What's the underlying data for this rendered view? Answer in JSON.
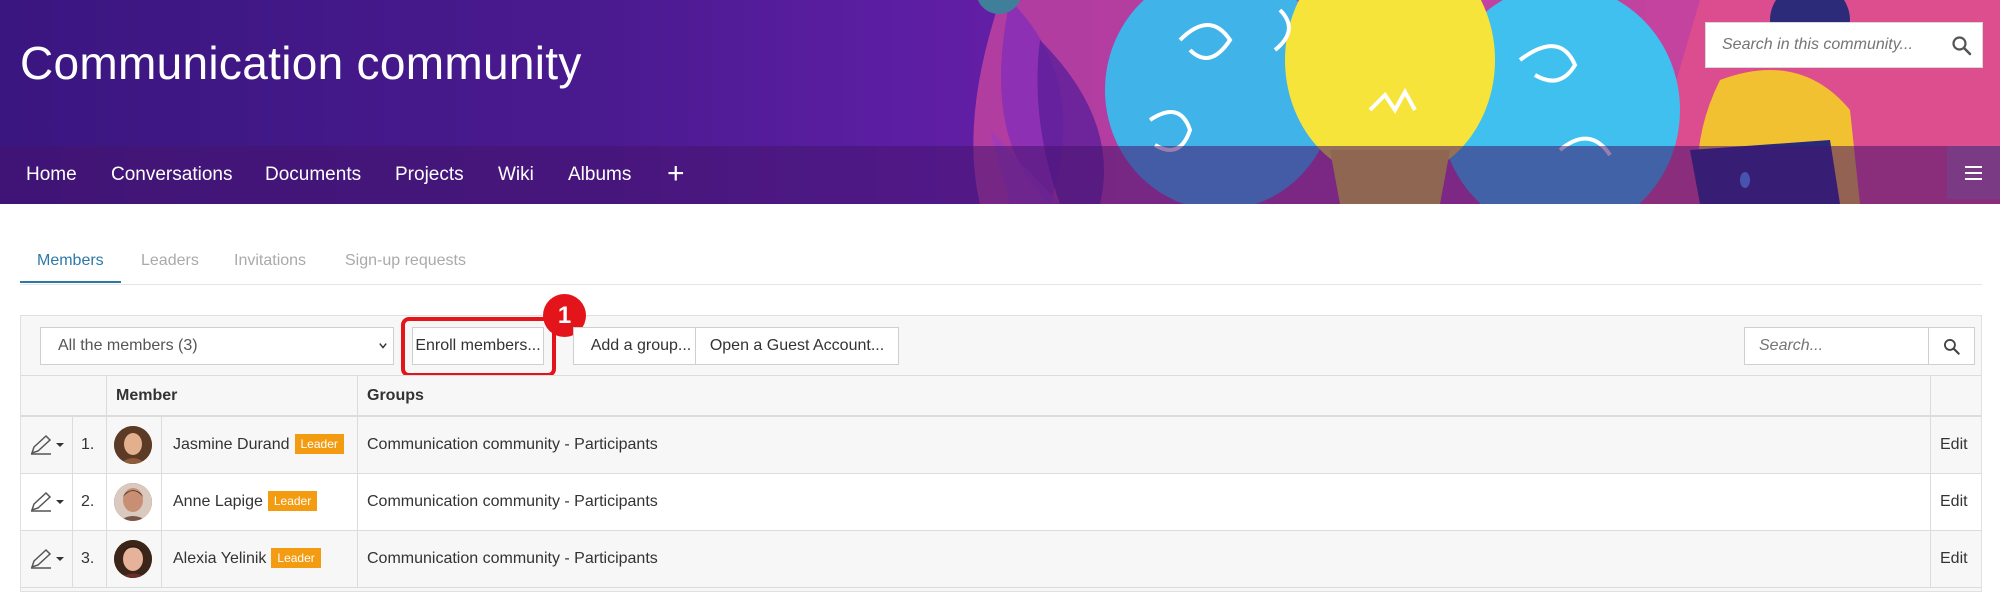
{
  "banner": {
    "title": "Communication community",
    "search_placeholder": "Search in this community...",
    "search_icon": "search-icon",
    "colors": {
      "deep_purple": "#3a1680",
      "magenta": "#b53fb3",
      "pink": "#e75a86",
      "bulb_yellow": "#f6e43a",
      "head_blue": "#3fb6ea"
    }
  },
  "nav": {
    "items": [
      "Home",
      "Conversations",
      "Documents",
      "Projects",
      "Wiki",
      "Albums"
    ],
    "add_label": "+",
    "menu_icon": "hamburger-menu-icon"
  },
  "tabs": {
    "items": [
      {
        "label": "Members",
        "active": true
      },
      {
        "label": "Leaders",
        "active": false
      },
      {
        "label": "Invitations",
        "active": false
      },
      {
        "label": "Sign-up requests",
        "active": false
      }
    ],
    "active_color": "#2c79a8"
  },
  "toolbar": {
    "filter_selected": "All the members (3)",
    "enroll_label": "Enroll members...",
    "add_group_label": "Add a group...",
    "guest_account_label": "Open a Guest Account...",
    "search_placeholder": "Search...",
    "highlight_step": "1",
    "highlight_color": "#e4141b"
  },
  "table": {
    "columns": {
      "member": "Member",
      "groups": "Groups"
    },
    "rows": [
      {
        "index": "1.",
        "name": "Jasmine Durand",
        "badge": "Leader",
        "group": "Communication community - Participants",
        "action": "Edit"
      },
      {
        "index": "2.",
        "name": "Anne Lapige",
        "badge": "Leader",
        "group": "Communication community - Participants",
        "action": "Edit"
      },
      {
        "index": "3.",
        "name": "Alexia Yelinik",
        "badge": "Leader",
        "group": "Communication community - Participants",
        "action": "Edit"
      }
    ],
    "badge_color": "#f39c12"
  }
}
